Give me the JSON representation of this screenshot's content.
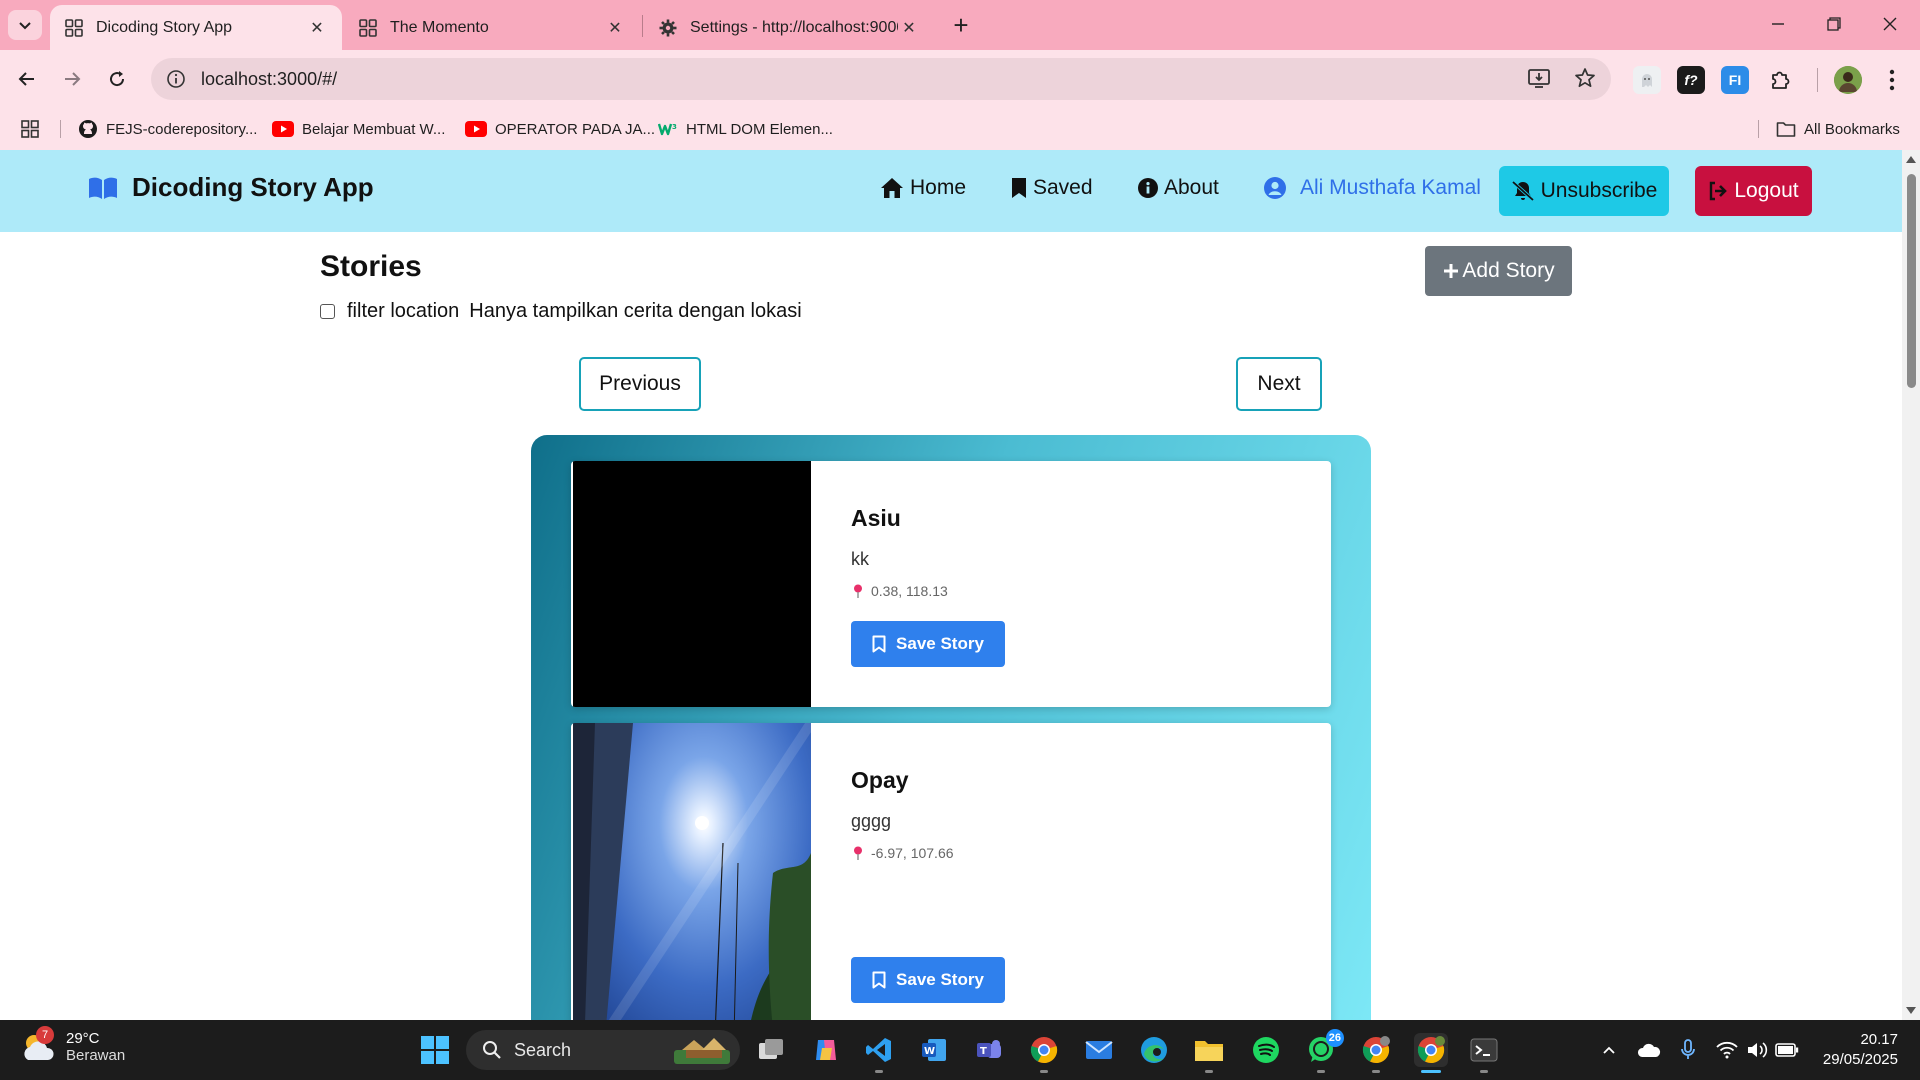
{
  "browser": {
    "tabs": [
      {
        "title": "Dicoding Story App"
      },
      {
        "title": "The Momento"
      },
      {
        "title": "Settings - http://localhost:9000"
      }
    ],
    "url": "localhost:3000/#/",
    "bookmarks": [
      {
        "label": "FEJS-coderepository..."
      },
      {
        "label": "Belajar Membuat W..."
      },
      {
        "label": "OPERATOR PADA JA..."
      },
      {
        "label": "HTML DOM Elemen..."
      }
    ],
    "all_bookmarks": "All Bookmarks"
  },
  "app": {
    "brand": "Dicoding Story App",
    "nav": {
      "home": "Home",
      "saved": "Saved",
      "about": "About",
      "user": "Ali Musthafa Kamal",
      "unsubscribe": "Unsubscribe",
      "logout": "Logout"
    },
    "stories_title": "Stories",
    "add_story": "Add Story",
    "filter_label": "filter location",
    "filter_hint": "Hanya tampilkan cerita dengan lokasi",
    "pagination": {
      "previous": "Previous",
      "next": "Next"
    },
    "stories": [
      {
        "name": "Asiu",
        "description": "kk",
        "location": "0.38, 118.13",
        "save_label": "Save Story"
      },
      {
        "name": "Opay",
        "description": "gggg",
        "location": "-6.97, 107.66",
        "save_label": "Save Story"
      }
    ]
  },
  "taskbar": {
    "weather": {
      "temp": "29°C",
      "condition": "Berawan",
      "alert_count": "7"
    },
    "search": "Search",
    "whatsapp_badge": "26",
    "clock": {
      "time": "20.17",
      "date": "29/05/2025"
    }
  },
  "colors": {
    "header_bg": "#aeeaf9",
    "unsubscribe": "#1ec9e6",
    "logout": "#c8103f",
    "save_button": "#2f80ed",
    "add_story": "#6c757d",
    "tab_strip": "#f8aabe"
  }
}
